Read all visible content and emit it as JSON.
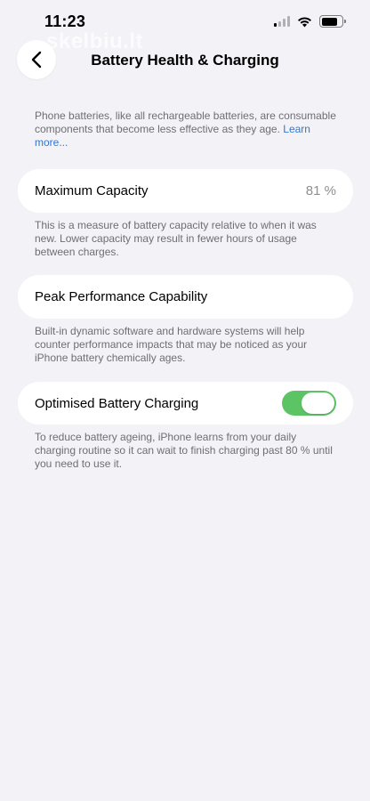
{
  "status_bar": {
    "time": "11:23",
    "signal_icon": "cellular-signal-icon",
    "wifi_icon": "wifi-icon",
    "battery_icon": "battery-icon"
  },
  "watermark": "skelbiu.lt",
  "nav": {
    "back_icon": "chevron-left-icon",
    "title": "Battery Health & Charging"
  },
  "intro": {
    "text": "Phone batteries, like all rechargeable batteries, are consumable components that become less effective as they age. ",
    "link": "Learn more..."
  },
  "maximum_capacity": {
    "label": "Maximum Capacity",
    "value": "81 %",
    "note": "This is a measure of battery capacity relative to when it was new. Lower capacity may result in fewer hours of usage between charges."
  },
  "peak_performance": {
    "label": "Peak Performance Capability",
    "note": "Built-in dynamic software and hardware systems will help counter performance impacts that may be noticed as your iPhone battery chemically ages."
  },
  "optimised_charging": {
    "label": "Optimised Battery Charging",
    "enabled": true,
    "toggle_color": "#5dc466",
    "note": "To reduce battery ageing, iPhone learns from your daily charging routine so it can wait to finish charging past 80 % until you need to use it."
  }
}
